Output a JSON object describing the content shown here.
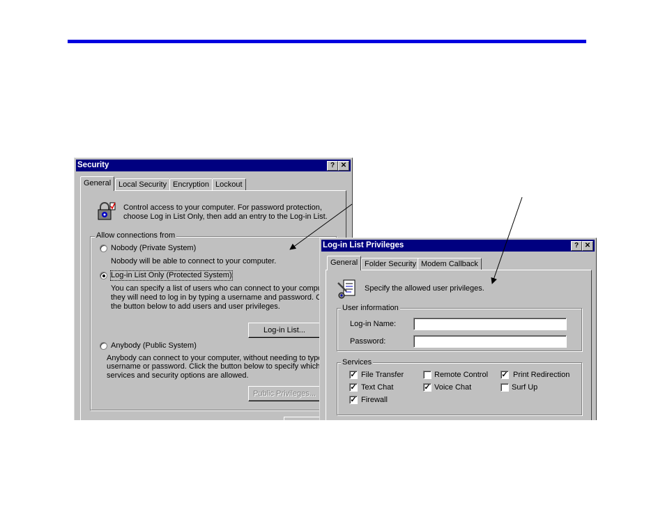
{
  "security_dialog": {
    "title": "Security",
    "help_button": "?",
    "close_button": "✕",
    "tabs": [
      "General",
      "Local Security",
      "Encryption",
      "Lockout"
    ],
    "intro_line1": "Control access to your computer.  For password protection,",
    "intro_line2": "choose Log in List Only, then add an entry to the Log-in List.",
    "group_label": "Allow connections from",
    "nobody_label": "Nobody (Private System)",
    "nobody_desc": "Nobody will be able to connect to your computer.",
    "loginlist_label": "Log-in List Only (Protected System)",
    "loginlist_desc1": "You can specify a list of users who can connect to your compute",
    "loginlist_desc2": "they will need to log in by typing a username and password.  Click",
    "loginlist_desc3": "the button below to add users and user privileges.",
    "loginlist_button": "Log-in List...",
    "anybody_label": "Anybody (Public System)",
    "anybody_desc1": "Anybody can connect to your computer, without needing to type a",
    "anybody_desc2": "username or password.  Click the button below to specify which",
    "anybody_desc3": "services and security options are allowed.",
    "public_button": "Public Privileges...",
    "selected_option": "loginlist"
  },
  "privileges_dialog": {
    "title": "Log-in List Privileges",
    "help_button": "?",
    "close_button": "✕",
    "tabs": [
      "General",
      "Folder Security",
      "Modem Callback"
    ],
    "intro": "Specify the allowed user privileges.",
    "user_info_label": "User information",
    "login_name_label": "Log-in Name:",
    "login_name_value": "",
    "password_label": "Password:",
    "password_value": "",
    "services_label": "Services",
    "services": [
      {
        "label": "File Transfer",
        "checked": true
      },
      {
        "label": "Remote Control",
        "checked": false
      },
      {
        "label": "Print Redirection",
        "checked": true
      },
      {
        "label": "Text Chat",
        "checked": true
      },
      {
        "label": "Voice Chat",
        "checked": true
      },
      {
        "label": "Surf Up",
        "checked": false
      },
      {
        "label": "Firewall",
        "checked": true
      }
    ]
  },
  "colors": {
    "rule": "#0000e0",
    "titlebar": "#000080",
    "face": "#c0c0c0"
  }
}
